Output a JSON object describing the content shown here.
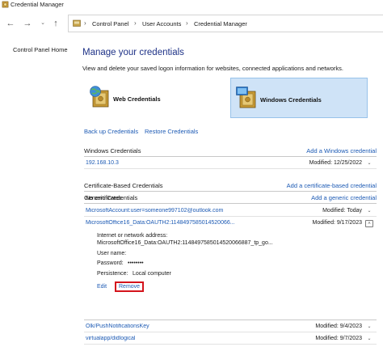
{
  "window": {
    "title": "Credential Manager"
  },
  "nav": {
    "breadcrumbs": [
      "Control Panel",
      "User Accounts",
      "Credential Manager"
    ]
  },
  "sidebar": {
    "home_link": "Control Panel Home"
  },
  "main": {
    "title": "Manage your credentials",
    "subtitle": "View and delete your saved logon information for websites, connected applications and networks.",
    "tiles": {
      "web": "Web Credentials",
      "windows": "Windows Credentials"
    },
    "backup_link": "Back up Credentials",
    "restore_link": "Restore Credentials"
  },
  "windows_credentials": {
    "header": "Windows Credentials",
    "add_link": "Add a Windows credential",
    "rows": [
      {
        "name": "192.168.10.3",
        "modified": "Modified:  12/25/2022"
      }
    ]
  },
  "certificate_credentials": {
    "header": "Certificate-Based Credentials",
    "add_link": "Add a certificate-based credential",
    "empty_text": "No certificates."
  },
  "generic_credentials": {
    "header": "Generic Credentials",
    "add_link": "Add a generic credential",
    "rows": [
      {
        "name": "MicrosoftAccount:user=someone997102@outlook.com",
        "modified": "Modified:  Today"
      },
      {
        "name": "MicrosoftOffice16_Data:OAUTH2:1148497585014520066...",
        "modified": "Modified:  9/17/2023"
      },
      {
        "name": "Olk/PushNotificationsKey",
        "modified": "Modified:  9/4/2023"
      },
      {
        "name": "virtualapp/didlogical",
        "modified": "Modified:  9/7/2023"
      }
    ],
    "expanded": {
      "address_label": "Internet or network address:",
      "address_value": "MicrosoftOffice16_Data:OAUTH2:1148497585014520066887_tp_go...",
      "username_label": "User name:",
      "password_label": "Password:",
      "password_value": "••••••••",
      "persistence_label": "Persistence:",
      "persistence_value": "Local computer",
      "edit_label": "Edit",
      "remove_label": "Remove"
    }
  },
  "colors": {
    "link": "#1c5ab4",
    "title": "#1e3287",
    "selected_tile": "#cfe3f7",
    "highlight": "#d4141c"
  }
}
